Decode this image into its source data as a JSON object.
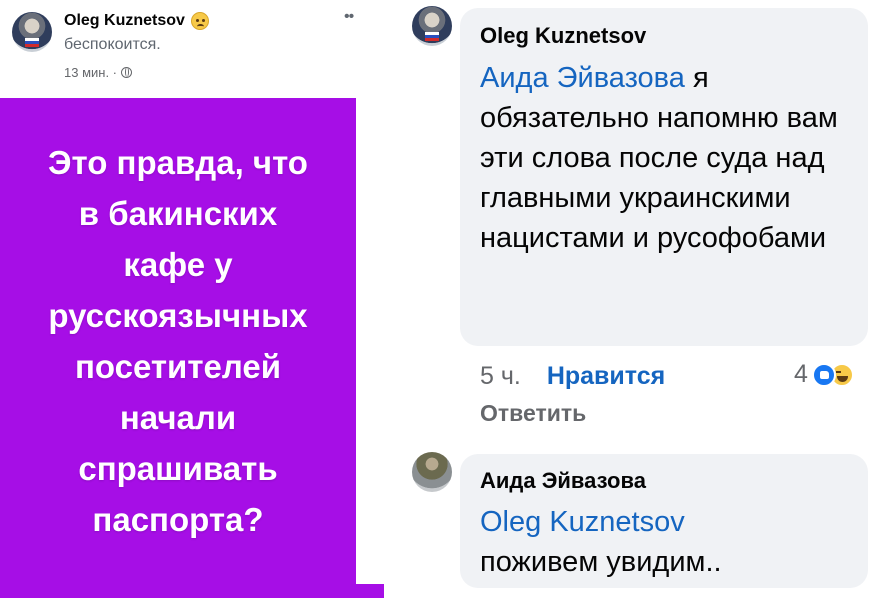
{
  "post": {
    "author": "Oleg Kuznetsov",
    "feeling": "беспокоится.",
    "time": "13 мин. ·",
    "image_text_lines": [
      "Это правда, что",
      "в бакинских",
      "кафе у",
      "русскоязычных",
      "посетителей",
      "начали",
      "спрашивать",
      "паспорта?"
    ],
    "background_color": "#a60ee6"
  },
  "comments": [
    {
      "author": "Oleg Kuznetsov",
      "mention": "Аида Эйвазова",
      "text": " я обязательно  напомню вам эти слова после суда над главными украинскими нацистами и русофобами",
      "time": "5 ч.",
      "like_label": "Нравится",
      "reply_label": "Ответить",
      "reaction_count": "4",
      "reaction_icons": [
        "like-icon",
        "haha-icon"
      ]
    },
    {
      "author": "Аида Эйвазова",
      "mention": "Oleg Kuznetsov",
      "text": "поживем увидим.."
    }
  ],
  "colors": {
    "bubble": "#f0f2f5",
    "link": "#1565c0",
    "secondary_text": "#65676b"
  }
}
